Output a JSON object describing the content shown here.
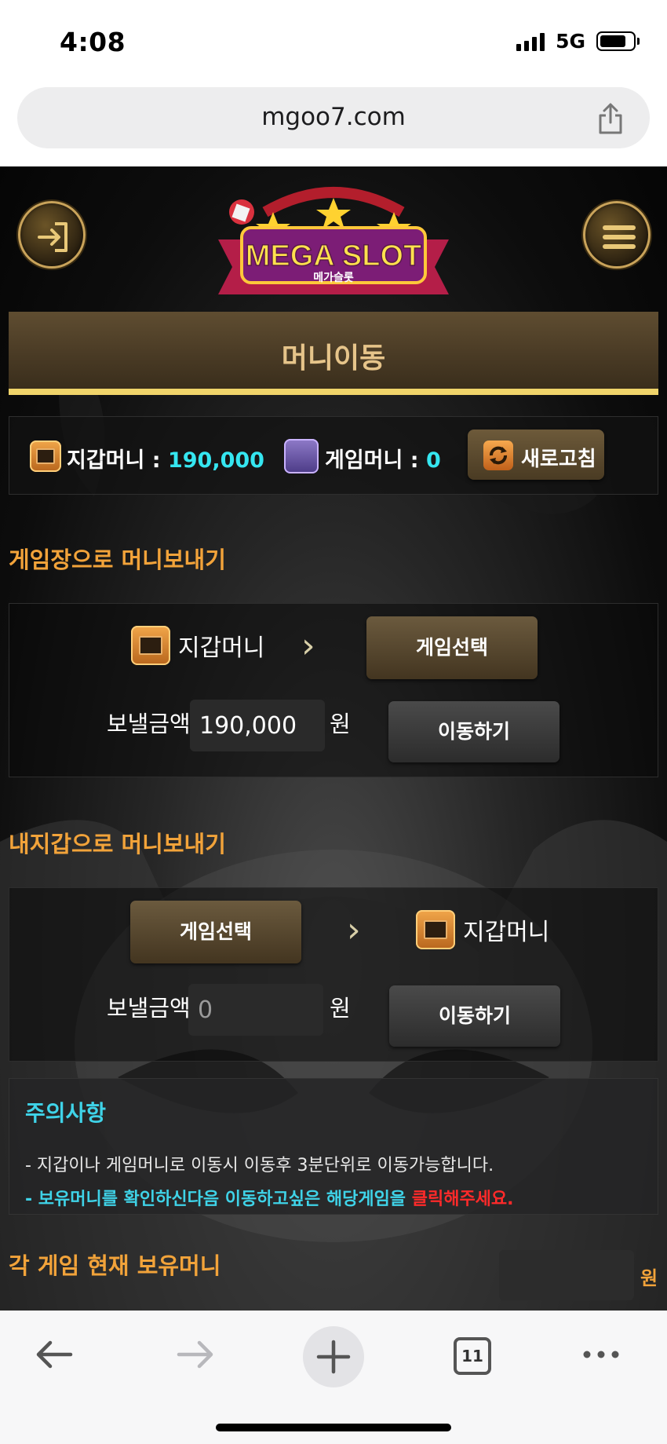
{
  "status": {
    "time": "4:08",
    "network": "5G"
  },
  "browser": {
    "url": "mgoo7.com",
    "tab_count": "11"
  },
  "header": {
    "logo_text": "MEGA SLOT",
    "logo_subtext": "메가슬롯"
  },
  "page_title": "머니이동",
  "balance": {
    "wallet_label": "지갑머니 : ",
    "wallet_value": "190,000",
    "game_label": "게임머니 : ",
    "game_value": "0",
    "refresh_label": "새로고침"
  },
  "send_to_game": {
    "heading": "게임장으로 머니보내기",
    "from_label": "지갑머니",
    "select_label": "게임선택",
    "amount_label": "보낼금액",
    "amount_value": "190,000",
    "unit": "원",
    "move_label": "이동하기"
  },
  "send_to_wallet": {
    "heading": "내지갑으로 머니보내기",
    "select_label": "게임선택",
    "to_label": "지갑머니",
    "amount_label": "보낼금액",
    "amount_placeholder": "0",
    "unit": "원",
    "move_label": "이동하기"
  },
  "notice": {
    "title": "주의사항",
    "line1": "- 지갑이나 게임머니로 이동시 이동후 3분단위로 이동가능합니다.",
    "line2_main": "- 보유머니를 확인하신다음 이동하고싶은 해당게임을 ",
    "line2_red": "클릭해주세요."
  },
  "holdings": {
    "heading": "각 게임 현재 보유머니",
    "unit": "원"
  },
  "colors": {
    "accent_orange": "#f2a33a",
    "accent_cyan": "#35e6f0",
    "gold_bar": "#f0d46a",
    "warning_red": "#ff2a2a"
  }
}
